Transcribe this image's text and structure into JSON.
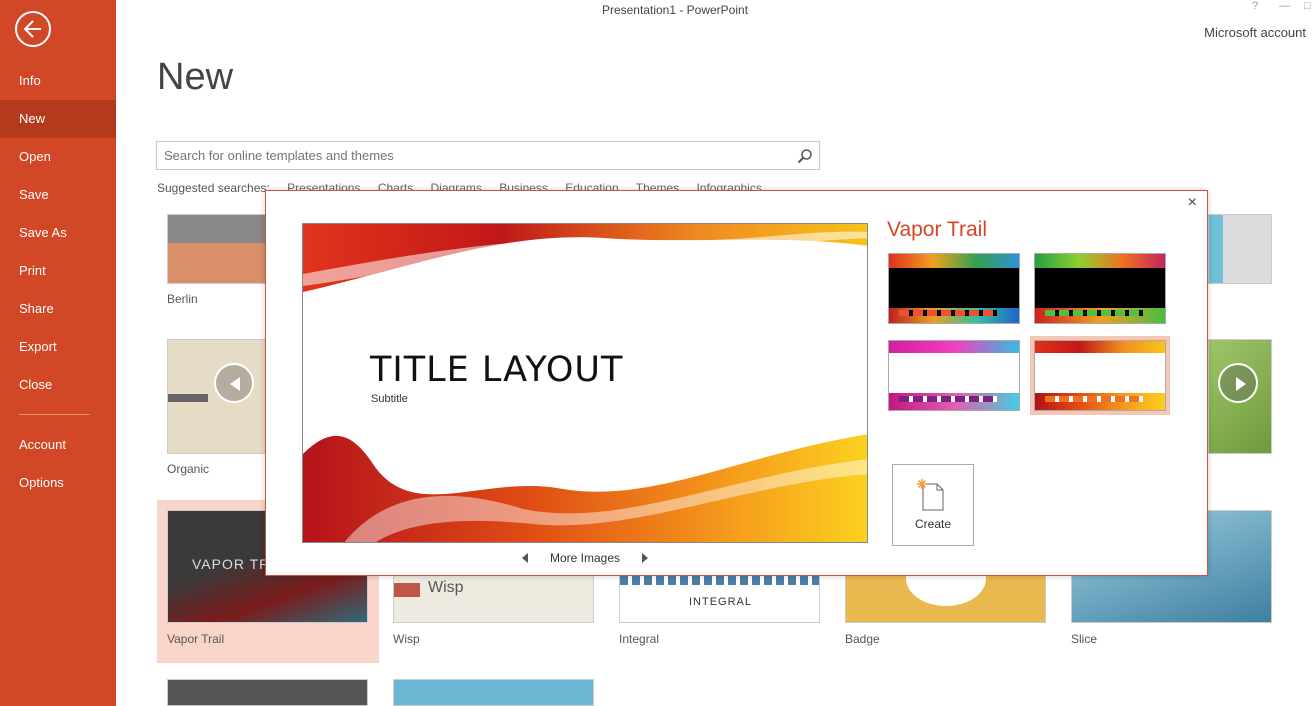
{
  "window": {
    "title": "Presentation1 - PowerPoint",
    "help": "?",
    "minimize": "—",
    "restore": "□",
    "account": "Microsoft account"
  },
  "sidebar": {
    "items": [
      {
        "label": "Info"
      },
      {
        "label": "New"
      },
      {
        "label": "Open"
      },
      {
        "label": "Save"
      },
      {
        "label": "Save As"
      },
      {
        "label": "Print"
      },
      {
        "label": "Share"
      },
      {
        "label": "Export"
      },
      {
        "label": "Close"
      },
      {
        "label": "Account"
      },
      {
        "label": "Options"
      }
    ],
    "active": "New"
  },
  "main": {
    "heading": "New",
    "search": {
      "placeholder": "Search for online templates and themes"
    },
    "suggested_label": "Suggested searches:",
    "suggested": [
      "Presentations",
      "Charts",
      "Diagrams",
      "Business",
      "Education",
      "Themes",
      "Infographics"
    ],
    "templates": [
      {
        "name": "Berlin"
      },
      {
        "name": "Organic"
      },
      {
        "name": "Vapor Trail",
        "thumb_text": "VAPOR TR"
      },
      {
        "name": "Wisp",
        "thumb_text": "Wisp"
      },
      {
        "name": "Integral",
        "thumb_text": "INTEGRAL"
      },
      {
        "name": "Badge"
      },
      {
        "name": "Slice"
      }
    ]
  },
  "dialog": {
    "close": "×",
    "theme_name": "Vapor Trail",
    "preview_title": "TITLE LAYOUT",
    "preview_subtitle": "Subtitle",
    "more_images": "More Images",
    "create_label": "Create",
    "variants": [
      "black-rainbow",
      "black-green",
      "white-magenta",
      "white-orange"
    ],
    "selected_variant": 4
  },
  "colors": {
    "accent": "#d24726",
    "sidebar_active": "#b33a1d"
  }
}
